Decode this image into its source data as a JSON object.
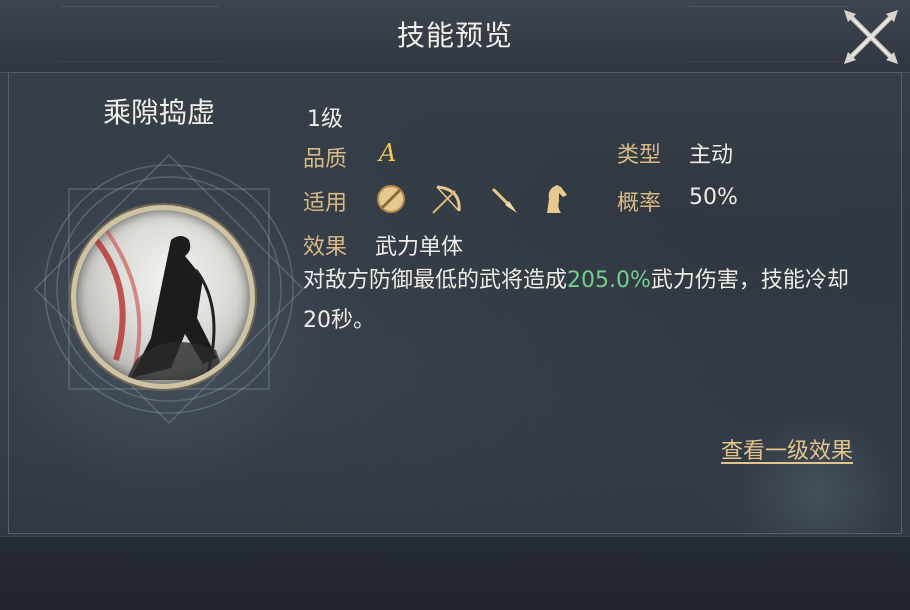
{
  "header": {
    "title": "技能预览",
    "close_icon": "close-x-icon"
  },
  "skill": {
    "name": "乘隙捣虚",
    "level": "1级",
    "quality_label": "品质",
    "quality_value": "A",
    "type_label": "类型",
    "type_value": "主动",
    "applicable_label": "适用",
    "applicable_icons": [
      "shield-icon",
      "bow-icon",
      "spear-icon",
      "horse-icon"
    ],
    "chance_label": "概率",
    "chance_value": "50%",
    "effect_label": "效果",
    "effect_value": "武力单体",
    "description_before": "对敌方防御最低的武将造成",
    "description_highlight": "205.0%",
    "description_after": "武力伤害，技能冷却20秒。",
    "view_link": "查看一级效果"
  },
  "colors": {
    "label_gold": "#d6b985",
    "highlight_green": "#74d18a",
    "grade_gold": "#f0c85a",
    "link_gold": "#e1c58b"
  }
}
